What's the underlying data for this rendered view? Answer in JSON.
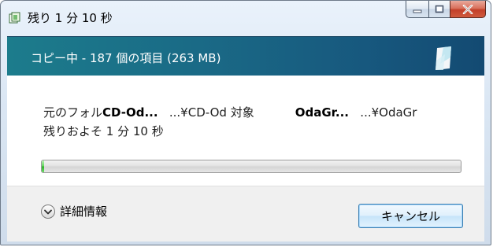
{
  "window": {
    "title": "残り 1 分 10 秒"
  },
  "banner": {
    "status_text": "コピー中 - 187 個の項目 (263 MB)"
  },
  "transfer": {
    "from_prefix": "元のフォル",
    "from_name": "CD-Od...",
    "from_path": "...¥CD-Od",
    "to_prefix": "対象",
    "to_name": "OdaGr...",
    "to_path": "...¥OdaGr",
    "remaining": "残りおよそ 1 分 10 秒"
  },
  "progress": {
    "fraction": 0.005
  },
  "footer": {
    "details_label": "詳細情報",
    "cancel_label": "キャンセル"
  },
  "colors": {
    "banner_start": "#1c7c8c",
    "banner_end": "#134a72",
    "progress_green": "#2cb02a",
    "close_red": "#c2402a"
  },
  "icons": {
    "title": "copy-file-icon",
    "details": "chevron-down-circle-icon",
    "banner": "document-glass-icon"
  }
}
